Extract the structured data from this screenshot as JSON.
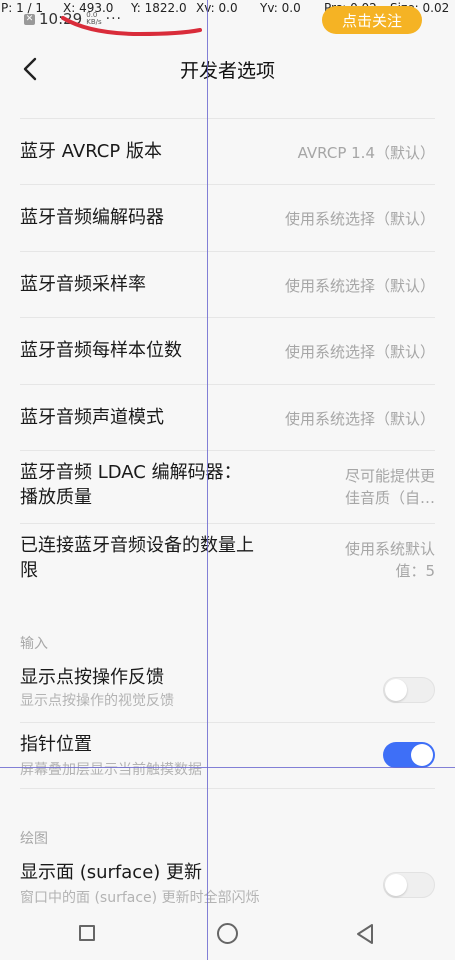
{
  "debug_overlay": {
    "pointer": "P: 1 / 1",
    "x": "X: 493.0",
    "y": "Y: 1822.0",
    "xv": "Xv: 0.0",
    "yv": "Yv: 0.0",
    "prs": "Prs: 0.02",
    "size": "Size: 0.02"
  },
  "status_bar": {
    "time": "10:29",
    "speed_value": "0.0",
    "speed_unit": "KB/s",
    "more": "···",
    "follow_button": "点击关注"
  },
  "header": {
    "title": "开发者选项"
  },
  "settings": [
    {
      "title": "蓝牙 AVRCP 版本",
      "value": "AVRCP 1.4（默认）"
    },
    {
      "title": "蓝牙音频编解码器",
      "value": "使用系统选择（默认）"
    },
    {
      "title": "蓝牙音频采样率",
      "value": "使用系统选择（默认）"
    },
    {
      "title": "蓝牙音频每样本位数",
      "value": "使用系统选择（默认）"
    },
    {
      "title": "蓝牙音频声道模式",
      "value": "使用系统选择（默认）"
    },
    {
      "title_line1": "蓝牙音频 LDAC 编解码器：",
      "title_line2": "播放质量",
      "value_line1": "尽可能提供更",
      "value_line2": "佳音质（自…"
    },
    {
      "title_line1": "已连接蓝牙音频设备的数量上",
      "title_line2": "限",
      "value_line1": "使用系统默认",
      "value_line2": "值：5"
    }
  ],
  "section_input": {
    "label": "输入",
    "items": [
      {
        "title": "显示点按操作反馈",
        "subtitle": "显示点按操作的视觉反馈",
        "enabled": false
      },
      {
        "title": "指针位置",
        "subtitle": "屏幕叠加层显示当前触摸数据",
        "enabled": true
      }
    ]
  },
  "section_drawing": {
    "label": "绘图",
    "items": [
      {
        "title": "显示面 (surface) 更新",
        "subtitle": "窗口中的面 (surface) 更新时全部闪烁",
        "enabled": false
      }
    ]
  },
  "colors": {
    "accent": "#3e6ff7",
    "follow_button": "#f5b324",
    "annotation_red": "#d92c3a",
    "crosshair": "#6d6ad0"
  },
  "icons": {
    "back": "chevron-left-icon",
    "nav_recent": "square-icon",
    "nav_home": "circle-icon",
    "nav_back": "triangle-back-icon"
  }
}
